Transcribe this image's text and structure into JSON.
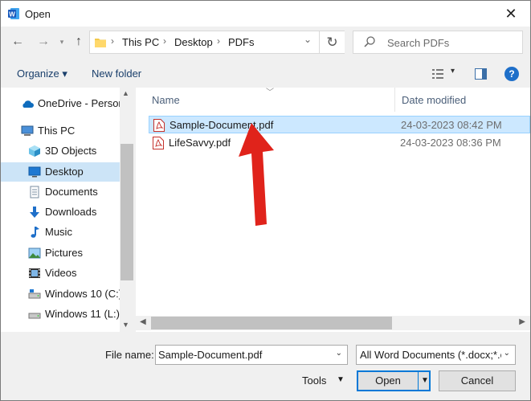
{
  "window": {
    "title": "Open",
    "close_glyph": "✕"
  },
  "nav": {
    "back_glyph": "←",
    "forward_glyph": "→",
    "up_glyph": "↑"
  },
  "address": {
    "crumbs": [
      "This PC",
      "Desktop",
      "PDFs"
    ],
    "separator": "›",
    "refresh_glyph": "↻"
  },
  "search": {
    "placeholder": "Search PDFs"
  },
  "toolbar": {
    "organize": "Organize ▾",
    "new_folder": "New folder",
    "help": "?"
  },
  "sidebar": {
    "items": [
      {
        "label": "OneDrive - Person",
        "icon": "cloud-icon"
      },
      {
        "label": "This PC",
        "icon": "computer-icon"
      },
      {
        "label": "3D Objects",
        "icon": "cube-icon"
      },
      {
        "label": "Desktop",
        "icon": "desktop-icon",
        "selected": true
      },
      {
        "label": "Documents",
        "icon": "documents-icon"
      },
      {
        "label": "Downloads",
        "icon": "download-icon"
      },
      {
        "label": "Music",
        "icon": "music-icon"
      },
      {
        "label": "Pictures",
        "icon": "pictures-icon"
      },
      {
        "label": "Videos",
        "icon": "videos-icon"
      },
      {
        "label": "Windows 10 (C:)",
        "icon": "drive-icon"
      },
      {
        "label": "Windows 11 (L:)",
        "icon": "drive-icon"
      }
    ]
  },
  "files": {
    "columns": {
      "name": "Name",
      "date": "Date modified"
    },
    "rows": [
      {
        "name": "Sample-Document.pdf",
        "date": "24-03-2023 08:42 PM",
        "selected": true
      },
      {
        "name": "LifeSavvy.pdf",
        "date": "24-03-2023 08:36 PM",
        "selected": false
      }
    ]
  },
  "bottom": {
    "file_name_label": "File name:",
    "file_name_value": "Sample-Document.pdf",
    "filter_value": "All Word Documents (*.docx;*.c",
    "tools_label": "Tools",
    "open_label": "Open",
    "cancel_label": "Cancel"
  },
  "colors": {
    "selection": "#cce8ff",
    "accent": "#0078d7",
    "pointer": "#e0231b"
  }
}
